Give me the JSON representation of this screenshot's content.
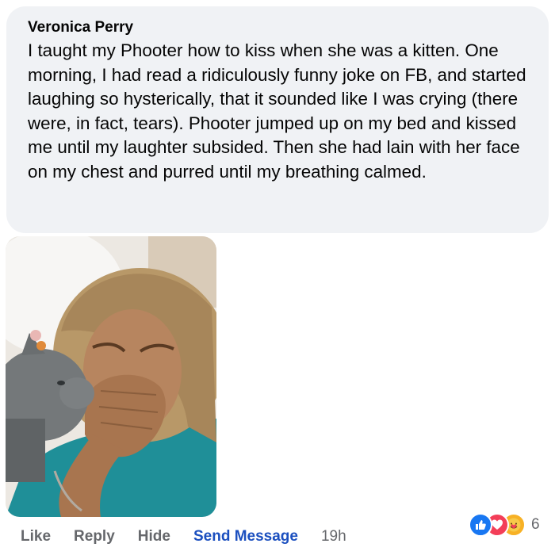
{
  "comment": {
    "author": "Veronica Perry",
    "text": "I taught my Phooter how to kiss when she was a kitten. One morning, I had read a ridiculously funny joke on FB, and started laughing so hysterically, that it sounded like I was crying (there were, in fact, tears). Phooter jumped up on my bed and kissed me until my laughter subsided. Then she had lain with her face on my chest and purred until my breathing calmed."
  },
  "actions": {
    "like": "Like",
    "reply": "Reply",
    "hide": "Hide",
    "send_message": "Send Message",
    "time": "19h"
  },
  "reactions": {
    "icons": [
      "like-icon",
      "love-icon",
      "care-icon"
    ],
    "count": "6"
  },
  "colors": {
    "bubble": "#f0f2f5",
    "link": "#1b4fbf",
    "muted": "#65676b",
    "like": "#1877f2",
    "love": "#f33e58",
    "care": "#f7b125"
  }
}
